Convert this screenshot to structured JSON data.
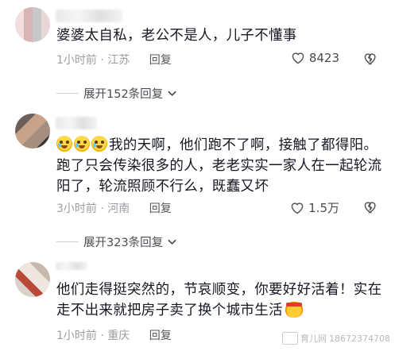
{
  "comments": [
    {
      "text": "婆婆太自私，老公不是人，儿子不懂事",
      "time": "1小时前",
      "location": "江苏",
      "reply_label": "回复",
      "likes": "8423",
      "expand_label": "展开152条回复"
    },
    {
      "text": "我的天啊，他们跑不了啊，接触了都得阳。跑了只会传染很多的人，老老实实一家人在一起轮流阳了，轮流照顾不行么，既蠢又坏",
      "time": "3小时前",
      "location": "河南",
      "reply_label": "回复",
      "likes": "1.5万",
      "expand_label": "展开323条回复"
    },
    {
      "text": "他们走得挺突然的，节哀顺变，你要好好活着！实在走不出来就把房子卖了换个城市生活",
      "time": "1小时前",
      "location": "重庆",
      "reply_label": "回复"
    }
  ],
  "watermark": {
    "site": "育儿网",
    "id": "18672374708"
  },
  "icons": {
    "like": "heart-outline-icon",
    "dislike": "broken-heart-icon",
    "expand": "chevron-down-icon"
  }
}
